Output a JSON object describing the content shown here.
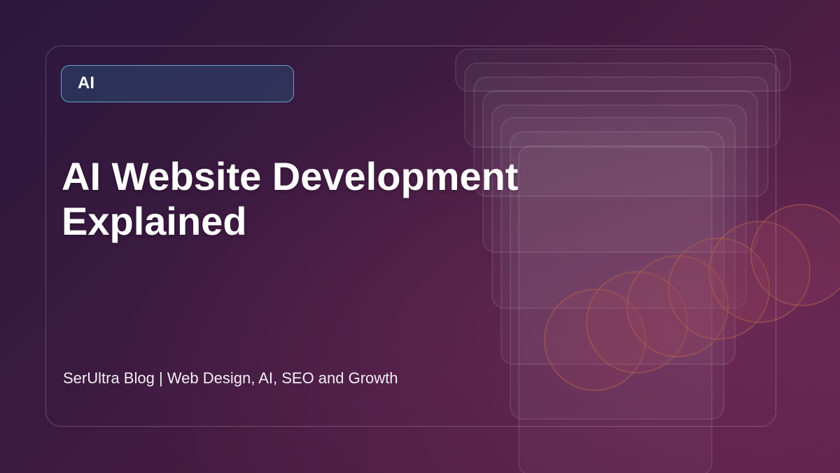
{
  "tag": {
    "label": "AI"
  },
  "headline": {
    "line1": "AI Website Development",
    "line2": "Explained"
  },
  "footer": {
    "text": "SerUltra Blog | Web Design, AI, SEO and Growth"
  },
  "colors": {
    "background_start": "#2b173d",
    "background_end": "#5b1f4a",
    "tag_border": "#5aa8c8",
    "circle_stroke": "#a0604e",
    "text": "#ffffff"
  }
}
